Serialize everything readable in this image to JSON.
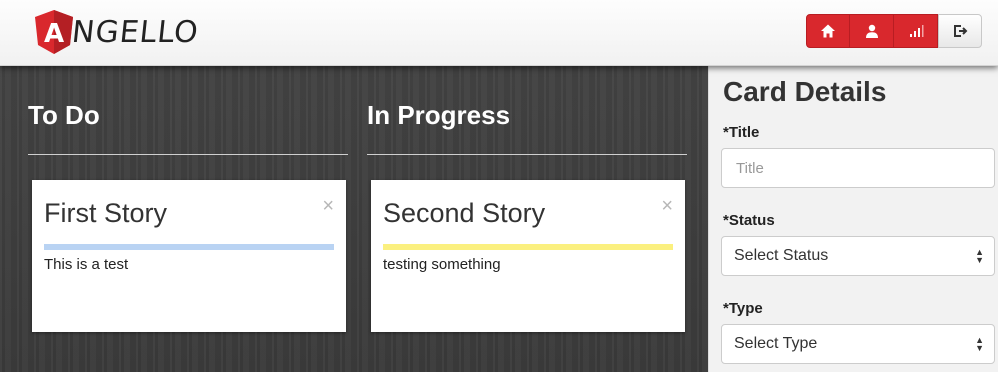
{
  "brand": {
    "name": "NGELLO",
    "logo_letter": "A"
  },
  "nav": {
    "buttons": [
      {
        "icon": "home-icon"
      },
      {
        "icon": "user-icon"
      },
      {
        "icon": "signal-icon"
      },
      {
        "icon": "logout-icon"
      }
    ]
  },
  "lanes": [
    {
      "title": "To Do",
      "card": {
        "title": "First Story",
        "description": "This is a test",
        "close": "×",
        "bar_color": "#b9d3f3"
      }
    },
    {
      "title": "In Progress",
      "card": {
        "title": "Second Story",
        "description": "testing something",
        "close": "×",
        "bar_color": "#fbf07f"
      }
    }
  ],
  "panel": {
    "title": "Card Details",
    "title_label": "*Title",
    "title_placeholder": "Title",
    "status_label": "*Status",
    "status_selected": "Select Status",
    "type_label": "*Type",
    "type_selected": "Select Type"
  },
  "colors": {
    "accent": "#d9282d"
  }
}
